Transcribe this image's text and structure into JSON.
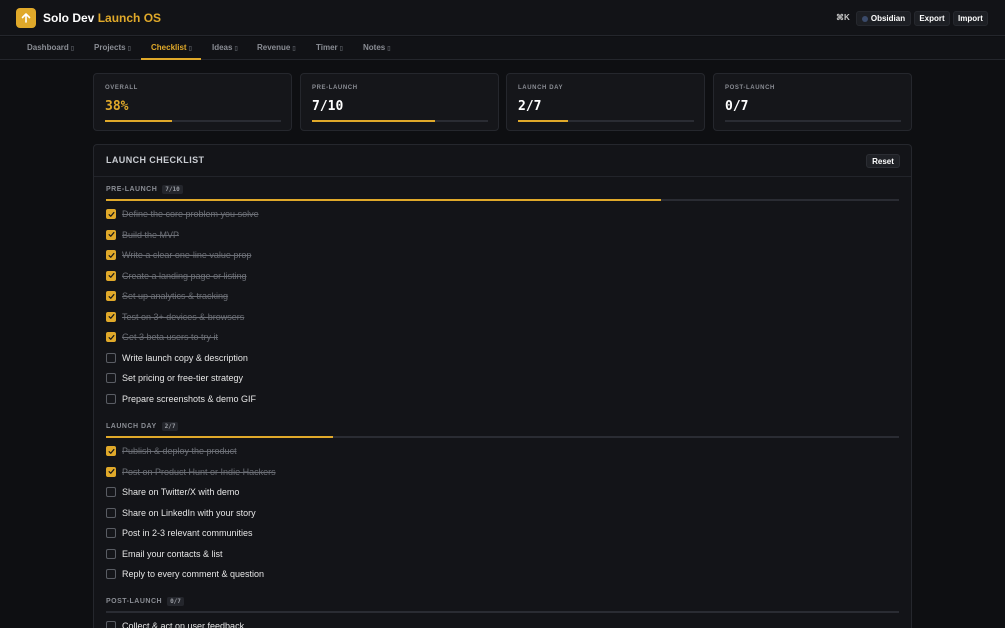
{
  "app": {
    "brand_primary": "Solo Dev",
    "brand_accent": "Launch OS",
    "shortcut": "⌘K",
    "buttons": {
      "obsidian": "Obsidian",
      "export": "Export",
      "import": "Import"
    },
    "accent_color": "#e0a92a"
  },
  "tabs": [
    {
      "label": "Dashboard",
      "active": false
    },
    {
      "label": "Projects",
      "active": false
    },
    {
      "label": "Checklist",
      "active": true
    },
    {
      "label": "Ideas",
      "active": false
    },
    {
      "label": "Revenue",
      "active": false
    },
    {
      "label": "Timer",
      "active": false
    },
    {
      "label": "Notes",
      "active": false
    }
  ],
  "stats": [
    {
      "label": "OVERALL",
      "value": "38%",
      "progress": 0.38
    },
    {
      "label": "PRE-LAUNCH",
      "value": "7/10",
      "progress": 0.7
    },
    {
      "label": "LAUNCH DAY",
      "value": "2/7",
      "progress": 0.286
    },
    {
      "label": "POST-LAUNCH",
      "value": "0/7",
      "progress": 0
    }
  ],
  "checklist": {
    "title": "LAUNCH CHECKLIST",
    "reset_label": "Reset",
    "sections": [
      {
        "title": "PRE-LAUNCH",
        "badge": "7/10",
        "progress": 0.7,
        "items": [
          {
            "text": "Define the core problem you solve",
            "done": true
          },
          {
            "text": "Build the MVP",
            "done": true
          },
          {
            "text": "Write a clear one-line value prop",
            "done": true
          },
          {
            "text": "Create a landing page or listing",
            "done": true
          },
          {
            "text": "Set up analytics & tracking",
            "done": true
          },
          {
            "text": "Test on 3+ devices & browsers",
            "done": true
          },
          {
            "text": "Get 3 beta users to try it",
            "done": true
          },
          {
            "text": "Write launch copy & description",
            "done": false
          },
          {
            "text": "Set pricing or free-tier strategy",
            "done": false
          },
          {
            "text": "Prepare screenshots & demo GIF",
            "done": false
          }
        ]
      },
      {
        "title": "LAUNCH DAY",
        "badge": "2/7",
        "progress": 0.286,
        "items": [
          {
            "text": "Publish & deploy the product",
            "done": true
          },
          {
            "text": "Post on Product Hunt or Indie Hackers",
            "done": true
          },
          {
            "text": "Share on Twitter/X with demo",
            "done": false
          },
          {
            "text": "Share on LinkedIn with your story",
            "done": false
          },
          {
            "text": "Post in 2-3 relevant communities",
            "done": false
          },
          {
            "text": "Email your contacts & list",
            "done": false
          },
          {
            "text": "Reply to every comment & question",
            "done": false
          }
        ]
      },
      {
        "title": "POST-LAUNCH",
        "badge": "0/7",
        "progress": 0,
        "items": [
          {
            "text": "Collect & act on user feedback",
            "done": false
          }
        ]
      }
    ]
  }
}
